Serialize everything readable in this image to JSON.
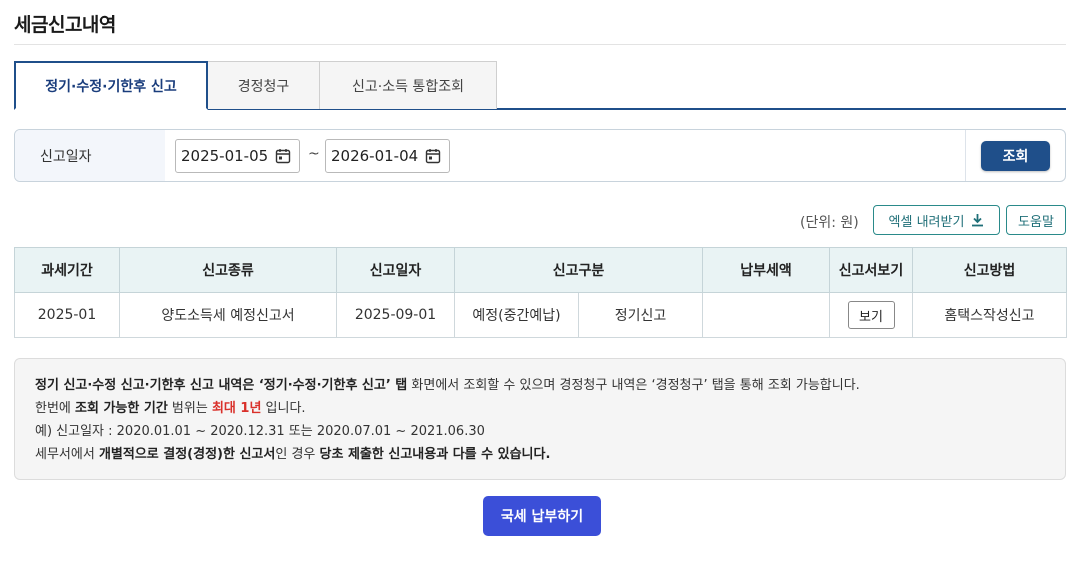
{
  "page": {
    "title": "세금신고내역"
  },
  "tabs": [
    {
      "label": "정기·수정·기한후 신고",
      "active": true
    },
    {
      "label": "경정청구",
      "active": false
    },
    {
      "label": "신고·소득 통합조회",
      "active": false
    }
  ],
  "search": {
    "label": "신고일자",
    "start_date": "2025-01-05",
    "separator": "~",
    "end_date": "2026-01-04",
    "button_label": "조회",
    "calendar_icon": "calendar-icon"
  },
  "toolbar": {
    "unit_text": "(단위: 원)",
    "excel_label": "엑셀 내려받기",
    "excel_icon": "download-icon",
    "help_label": "도움말"
  },
  "table": {
    "headers": [
      "과세기간",
      "신고종류",
      "신고일자",
      "신고구분",
      "납부세액",
      "신고서보기",
      "신고방법"
    ],
    "rows": [
      {
        "period": "2025-01",
        "type": "양도소득세 예정신고서",
        "date": "2025-09-01",
        "category_1": "예정(중간예납)",
        "category_2": "정기신고",
        "tax_amount": "",
        "view_label": "보기",
        "method": "홈택스작성신고"
      }
    ]
  },
  "notice": {
    "line1": {
      "a": "정기 신고·수정 신고·기한후 신고 내역은 ‘정기·수정·기한후 신고’ 탭",
      "b": " 화면에서 조회할 수 있으며 경정청구 내역은 ‘경정청구’ 탭을 통해 조회 가능합니다."
    },
    "line2": {
      "a": "한번에 ",
      "b": "조회 가능한 기간",
      "c": " 범위는 ",
      "d": "최대 1년",
      "e": " 입니다."
    },
    "line3": "예) 신고일자 : 2020.01.01 ~ 2020.12.31 또는 2020.07.01 ~ 2021.06.30",
    "line4": {
      "a": "세무서에서 ",
      "b": "개별적으로 결정(경정)한 신고서",
      "c": "인 경우 ",
      "d": "당초 제출한 신고내용과 다를 수 있습니다."
    }
  },
  "pay_button": {
    "label": "국세 납부하기"
  },
  "colors": {
    "primary": "#1f4f8a",
    "teal": "#2a8a8a",
    "header_bg": "#e9f3f4",
    "pay_button": "#3b4fd8",
    "highlight_red": "#d9302a"
  }
}
